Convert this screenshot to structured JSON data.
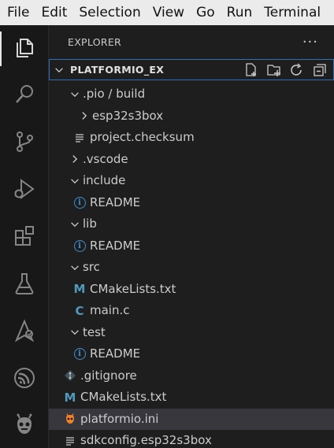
{
  "menubar": {
    "items": [
      "File",
      "Edit",
      "Selection",
      "View",
      "Go",
      "Run",
      "Terminal"
    ]
  },
  "activity": {
    "items": [
      "explorer-icon",
      "search-icon",
      "source-control-icon",
      "run-debug-icon",
      "extensions-icon",
      "testing-icon",
      "remote-explorer-icon",
      "espressif-icon",
      "platformio-icon"
    ],
    "active": "explorer-icon"
  },
  "explorer": {
    "title": "EXPLORER",
    "more": "···",
    "folder": {
      "name": "PLATFORMIO_EX",
      "actions": [
        "new-file-icon",
        "new-folder-icon",
        "refresh-icon",
        "collapse-all-icon"
      ]
    },
    "tree": [
      {
        "label": ".pio / build",
        "kind": "folder",
        "expanded": true,
        "depth": 1
      },
      {
        "label": "esp32s3box",
        "kind": "folder",
        "expanded": false,
        "depth": 2
      },
      {
        "label": "project.checksum",
        "kind": "lines",
        "depth": 2
      },
      {
        "label": ".vscode",
        "kind": "folder",
        "expanded": false,
        "depth": 1
      },
      {
        "label": "include",
        "kind": "folder",
        "expanded": true,
        "depth": 1
      },
      {
        "label": "README",
        "kind": "info",
        "depth": 2
      },
      {
        "label": "lib",
        "kind": "folder",
        "expanded": true,
        "depth": 1
      },
      {
        "label": "README",
        "kind": "info",
        "depth": 2
      },
      {
        "label": "src",
        "kind": "folder",
        "expanded": true,
        "depth": 1
      },
      {
        "label": "CMakeLists.txt",
        "kind": "cmake",
        "depth": 2
      },
      {
        "label": "main.c",
        "kind": "c",
        "depth": 2
      },
      {
        "label": "test",
        "kind": "folder",
        "expanded": true,
        "depth": 1
      },
      {
        "label": "README",
        "kind": "info",
        "depth": 2
      },
      {
        "label": ".gitignore",
        "kind": "git",
        "depth": 1
      },
      {
        "label": "CMakeLists.txt",
        "kind": "cmake",
        "depth": 1
      },
      {
        "label": "platformio.ini",
        "kind": "pio",
        "depth": 1,
        "selected": true
      },
      {
        "label": "sdkconfig.esp32s3box",
        "kind": "lines",
        "depth": 1
      }
    ]
  },
  "colors": {
    "accent": "#2f6fba",
    "selection": "#37373d",
    "info": "#3e8ed0",
    "cmake": "#519aba",
    "pio": "#f5822a"
  }
}
